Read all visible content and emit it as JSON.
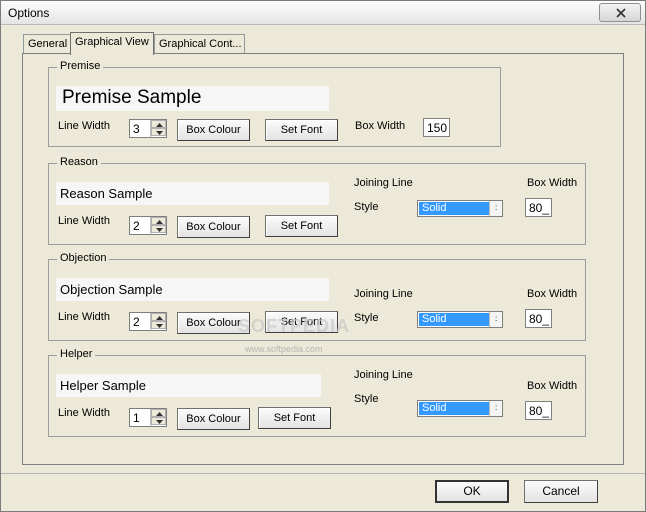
{
  "window": {
    "title": "Options"
  },
  "tabs": [
    {
      "label": "General"
    },
    {
      "label": "Graphical View"
    },
    {
      "label": "Graphical Cont..."
    }
  ],
  "premise": {
    "group_label": "Premise",
    "sample_text": "Premise Sample",
    "line_width_label": "Line Width",
    "line_width_value": "3",
    "box_colour_label": "Box Colour",
    "set_font_label": "Set Font",
    "box_width_label": "Box Width",
    "box_width_value": "150"
  },
  "reason": {
    "group_label": "Reason",
    "sample_text": "Reason Sample",
    "line_width_label": "Line Width",
    "line_width_value": "2",
    "box_colour_label": "Box Colour",
    "set_font_label": "Set Font",
    "joining_line_label": "Joining Line",
    "style_label": "Style",
    "style_value": "Solid",
    "box_width_label": "Box Width",
    "box_width_value": "80_"
  },
  "objection": {
    "group_label": "Objection",
    "sample_text": "Objection Sample",
    "line_width_label": "Line Width",
    "line_width_value": "2",
    "box_colour_label": "Box Colour",
    "set_font_label": "Set Font",
    "joining_line_label": "Joining Line",
    "style_label": "Style",
    "style_value": "Solid",
    "box_width_label": "Box Width",
    "box_width_value": "80_"
  },
  "helper": {
    "group_label": "Helper",
    "sample_text": "Helper Sample",
    "line_width_label": "Line Width",
    "line_width_value": "1",
    "box_colour_label": "Box Colour",
    "set_font_label": "Set Font",
    "joining_line_label": "Joining Line",
    "style_label": "Style",
    "style_value": "Solid",
    "box_width_label": "Box Width",
    "box_width_value": "80_"
  },
  "buttons": {
    "ok": "OK",
    "cancel": "Cancel"
  },
  "watermark": {
    "text": "SOFTPEDIA",
    "url": "www.softpedia.com"
  },
  "colors": {
    "selection": "#3399ff",
    "face": "#ece9d8"
  }
}
